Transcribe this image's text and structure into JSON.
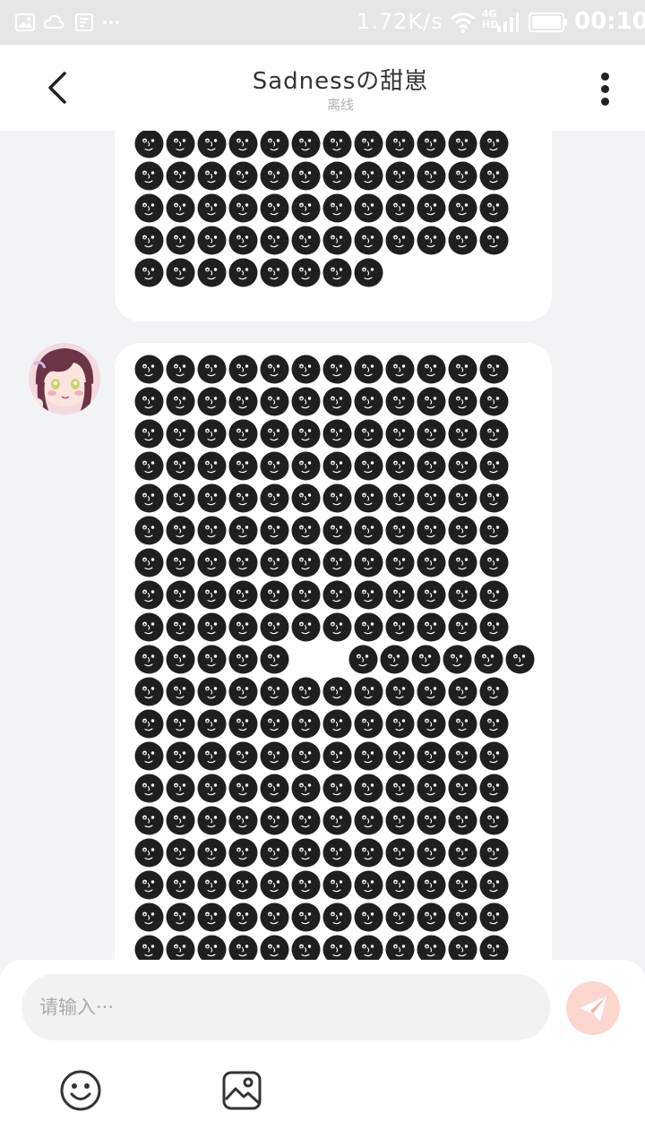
{
  "status_bar": {
    "net_speed": "1.72K/s",
    "network_type_top": "4G",
    "network_type_bottom": "HD",
    "time": "00:10",
    "icons": [
      "image-icon",
      "cloud-icon",
      "notification-icon",
      "more-notifications-icon",
      "wifi-icon",
      "signal-icon",
      "battery-icon"
    ]
  },
  "header": {
    "title": "Sadnessの甜崽",
    "subtitle": "离线",
    "icons": [
      "back-arrow-icon",
      "more-vertical-icon"
    ]
  },
  "messages": [
    {
      "sender": "self",
      "content_icon": "black-moon-face-emoji",
      "visible_rows": [
        12,
        12,
        12,
        12,
        12,
        8
      ]
    },
    {
      "sender": "contact",
      "avatar_icon": "anime-girl-avatar",
      "content_icon": "black-moon-face-emoji",
      "visible_rows": [
        12,
        12,
        12,
        12,
        12,
        12,
        12,
        12,
        12,
        11,
        12,
        12,
        12,
        12,
        12,
        12,
        12,
        12,
        12
      ]
    }
  ],
  "composer": {
    "placeholder": "请输入···",
    "value": "",
    "icons": [
      "send-icon",
      "emoji-icon",
      "image-icon"
    ]
  },
  "colors": {
    "status_bar_bg": "#e6e6e6",
    "page_bg": "#f2f3f5",
    "bubble_bg": "#ffffff",
    "emoji_fill": "#1f1f1f",
    "send_button_bg": "#fcd6cf"
  }
}
